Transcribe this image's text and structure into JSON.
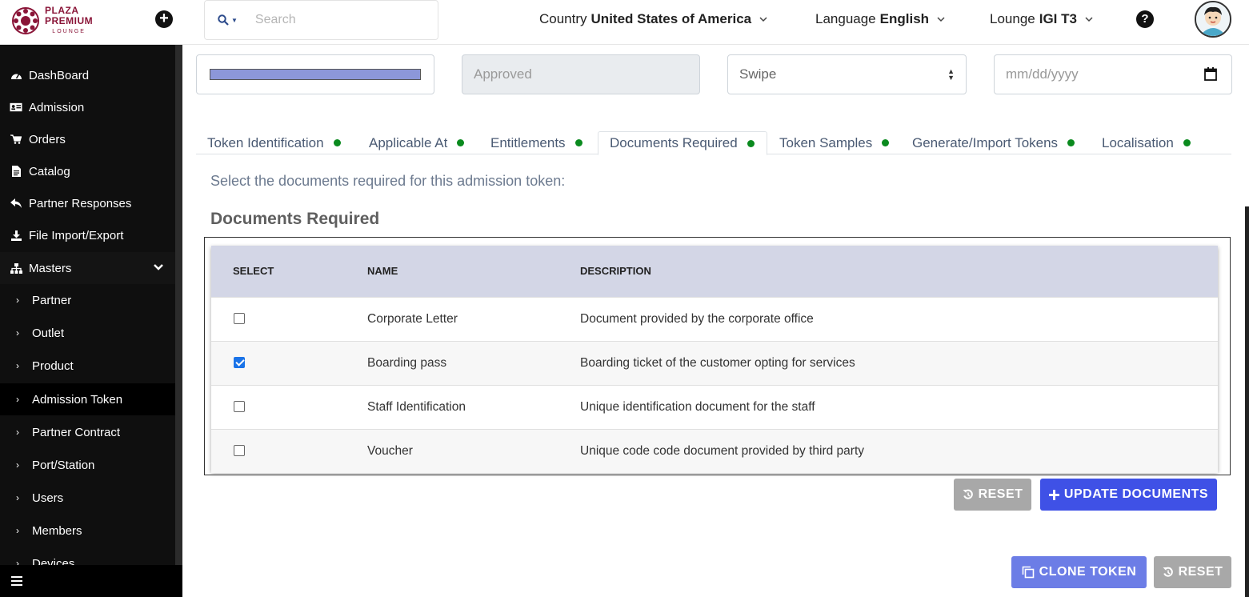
{
  "topbar": {
    "logo": {
      "line1": "PLAZA",
      "line2": "PREMIUM",
      "line3": "LOUNGE"
    },
    "search": {
      "placeholder": "Search"
    },
    "country": {
      "label": "Country",
      "value": "United States of America"
    },
    "language": {
      "label": "Language",
      "value": "English"
    },
    "lounge": {
      "label": "Lounge",
      "value": "IGI T3"
    }
  },
  "sidebar": {
    "items": [
      {
        "label": "DashBoard",
        "icon": "dashboard-icon"
      },
      {
        "label": "Admission",
        "icon": "id-card-icon"
      },
      {
        "label": "Orders",
        "icon": "cart-icon"
      },
      {
        "label": "Catalog",
        "icon": "document-icon"
      },
      {
        "label": "Partner Responses",
        "icon": "reply-icon"
      },
      {
        "label": "File Import/Export",
        "icon": "download-icon"
      },
      {
        "label": "Masters",
        "icon": "sitemap-icon"
      }
    ],
    "sub_items": [
      {
        "label": "Partner"
      },
      {
        "label": "Outlet"
      },
      {
        "label": "Product"
      },
      {
        "label": "Admission Token"
      },
      {
        "label": "Partner Contract"
      },
      {
        "label": "Port/Station"
      },
      {
        "label": "Users"
      },
      {
        "label": "Members"
      },
      {
        "label": "Devices"
      }
    ],
    "active_item": "Admission Token"
  },
  "form": {
    "color_value": "#8c97d9",
    "status_value": "Approved",
    "type_value": "Swipe",
    "date_placeholder": "mm/dd/yyyy"
  },
  "tabs": [
    {
      "label": "Token Identification",
      "status_color": "#0a8a1e"
    },
    {
      "label": "Applicable At",
      "status_color": "#0a8a1e"
    },
    {
      "label": "Entitlements",
      "status_color": "#0a8a1e"
    },
    {
      "label": "Documents Required",
      "status_color": "#0a8a1e",
      "active": true
    },
    {
      "label": "Token Samples",
      "status_color": "#0a8a1e"
    },
    {
      "label": "Generate/Import Tokens",
      "status_color": "#0a8a1e"
    },
    {
      "label": "Localisation",
      "status_color": "#0a8a1e"
    }
  ],
  "documents": {
    "instruction": "Select the documents required for this admission token:",
    "title": "Documents Required",
    "columns": {
      "select": "SELECT",
      "name": "NAME",
      "description": "DESCRIPTION"
    },
    "rows": [
      {
        "name": "Corporate Letter",
        "description": "Document provided by the corporate office",
        "selected": false
      },
      {
        "name": "Boarding pass",
        "description": "Boarding ticket of the customer opting for services",
        "selected": true
      },
      {
        "name": "Staff Identification",
        "description": "Unique identification document for the staff",
        "selected": false
      },
      {
        "name": "Voucher",
        "description": "Unique code code document provided by third party",
        "selected": false
      }
    ],
    "reset_label": "RESET",
    "update_label": "UPDATE DOCUMENTS"
  },
  "footer_actions": {
    "clone_label": "CLONE TOKEN",
    "reset_label": "RESET"
  }
}
